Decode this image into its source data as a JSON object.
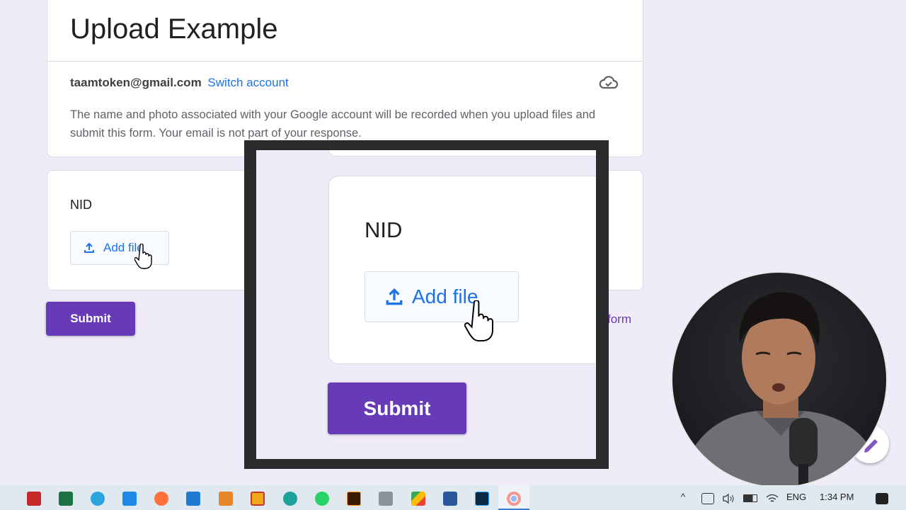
{
  "form": {
    "title": "Upload Example",
    "email": "taamtoken@gmail.com",
    "switch_account": "Switch account",
    "notice": "The name and photo associated with your Google account will be recorded when you upload files and submit this form. Your email is not part of your response.",
    "question_label": "NID",
    "add_file_label": "Add file",
    "submit_label": "Submit",
    "clear_form_partial": "form"
  },
  "zoom": {
    "question_label": "NID",
    "add_file_label": "Add file",
    "submit_label": "Submit"
  },
  "taskbar": {
    "apps": [
      "acrobat-icon",
      "excel-icon",
      "telegram-icon",
      "photos-icon",
      "firefox-icon",
      "vscode-icon",
      "sublime-icon",
      "notes-icon",
      "edge-icon",
      "whatsapp-icon",
      "illustrator-icon",
      "calculator-icon",
      "drive-icon",
      "word-icon",
      "photoshop-icon",
      "chrome-icon"
    ],
    "language": "ENG",
    "time": "1:34 PM"
  },
  "colors": {
    "accent": "#673ab7",
    "link": "#1a73e8",
    "background": "#f0ebf8"
  }
}
